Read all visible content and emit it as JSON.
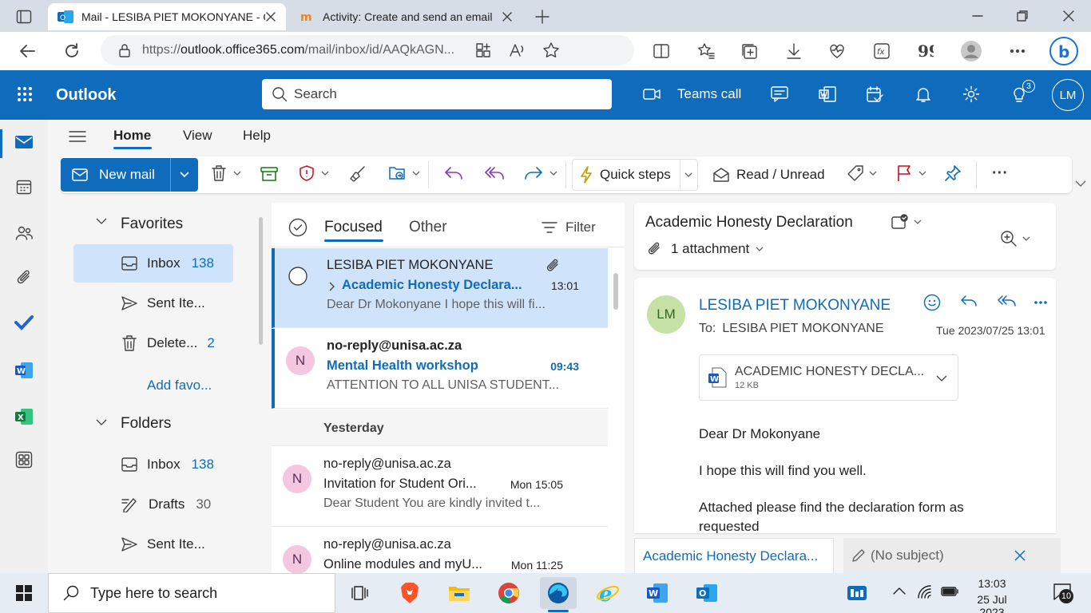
{
  "browser": {
    "tabs": [
      {
        "title": "Mail - LESIBA PIET MOKONYANE - Outlook",
        "active": true
      },
      {
        "title": "Activity: Create and send an email",
        "active": false
      }
    ],
    "url_prefix": "https://",
    "url_host": "outlook.office365.com",
    "url_path": "/mail/inbox/id/AAQkAGN..."
  },
  "outlook": {
    "app_title": "Outlook",
    "search_placeholder": "Search",
    "teams_call_label": "Teams call",
    "tips_badge": "3",
    "user_initials": "LM"
  },
  "ribbon": {
    "tabs": [
      "Home",
      "View",
      "Help"
    ],
    "active_tab": "Home",
    "new_mail_label": "New mail",
    "quick_steps_label": "Quick steps",
    "read_unread_label": "Read / Unread",
    "more_label": "···"
  },
  "folders": {
    "favorites_label": "Favorites",
    "favorites": [
      {
        "label": "Inbox",
        "count": "138",
        "selected": true
      },
      {
        "label": "Sent Ite...",
        "count": ""
      },
      {
        "label": "Delete...",
        "count": "2"
      }
    ],
    "add_favorite_label": "Add favo...",
    "folders_label": "Folders",
    "items": [
      {
        "label": "Inbox",
        "count": "138"
      },
      {
        "label": "Drafts",
        "count": "30"
      },
      {
        "label": "Sent Ite...",
        "count": ""
      }
    ]
  },
  "message_list": {
    "focused_label": "Focused",
    "other_label": "Other",
    "filter_label": "Filter",
    "yesterday_label": "Yesterday",
    "messages": [
      {
        "from": "LESIBA PIET MOKONYANE",
        "subject": "Academic Honesty Declara...",
        "time": "13:01",
        "preview": "Dear Dr Mokonyane I hope this will fi...",
        "avatar": ""
      },
      {
        "from": "no-reply@unisa.ac.za",
        "subject": "Mental Health workshop",
        "time": "09:43",
        "preview": "ATTENTION TO ALL UNISA STUDENT...",
        "avatar": "N"
      },
      {
        "from": "no-reply@unisa.ac.za",
        "subject": "Invitation for Student Ori...",
        "time": "Mon 15:05",
        "preview": "Dear Student You are kindly invited t...",
        "avatar": "N"
      },
      {
        "from": "no-reply@unisa.ac.za",
        "subject": "Online modules and myU...",
        "time": "Mon 11:25",
        "preview": "",
        "avatar": "N"
      }
    ]
  },
  "reading_pane": {
    "subject": "Academic Honesty Declaration",
    "attachment_summary": "1 attachment",
    "sender_initials": "LM",
    "sender_name": "LESIBA PIET MOKONYANE",
    "to_label": "To:",
    "to_value": "LESIBA PIET MOKONYANE",
    "date": "Tue 2023/07/25 13:01",
    "attachment_name": "ACADEMIC HONESTY DECLA...",
    "attachment_size": "12 KB",
    "body_lines": [
      "Dear Dr Mokonyane",
      "I hope this will find you well.",
      "Attached please find the declaration form as",
      "requested"
    ],
    "bottom_tab_1": "Academic Honesty Declara...",
    "bottom_tab_2": "(No subject)"
  },
  "taskbar": {
    "search_placeholder": "Type here to search",
    "time": "13:03",
    "date": "25 Jul 2023",
    "notifications": "10"
  },
  "colors": {
    "brand": "#0f6cbd",
    "selected": "#cfe4fa"
  }
}
